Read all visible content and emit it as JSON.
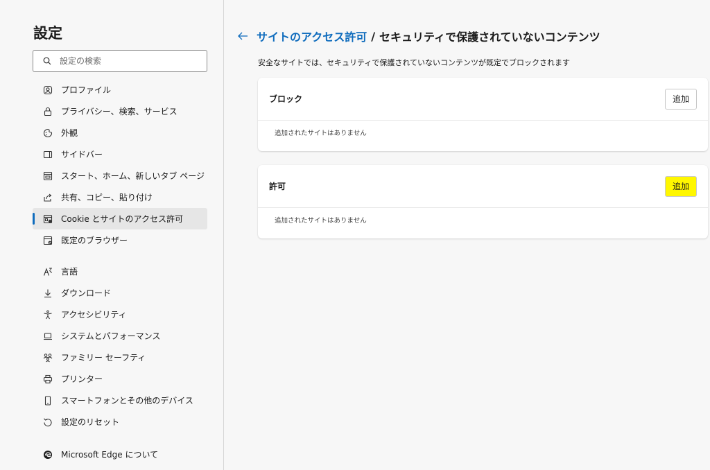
{
  "sidebar": {
    "title": "設定",
    "search_placeholder": "設定の検索",
    "items": [
      {
        "label": "プロファイル",
        "icon": "profile-icon"
      },
      {
        "label": "プライバシー、検索、サービス",
        "icon": "lock-icon"
      },
      {
        "label": "外観",
        "icon": "appearance-icon"
      },
      {
        "label": "サイドバー",
        "icon": "sidebar-icon"
      },
      {
        "label": "スタート、ホーム、新しいタブ ページ",
        "icon": "home-page-icon"
      },
      {
        "label": "共有、コピー、貼り付け",
        "icon": "share-icon"
      },
      {
        "label": "Cookie とサイトのアクセス許可",
        "icon": "cookie-icon",
        "active": true
      },
      {
        "label": "既定のブラウザー",
        "icon": "default-browser-icon"
      },
      {
        "label": "言語",
        "icon": "language-icon"
      },
      {
        "label": "ダウンロード",
        "icon": "download-icon"
      },
      {
        "label": "アクセシビリティ",
        "icon": "accessibility-icon"
      },
      {
        "label": "システムとパフォーマンス",
        "icon": "system-icon"
      },
      {
        "label": "ファミリー セーフティ",
        "icon": "family-icon"
      },
      {
        "label": "プリンター",
        "icon": "printer-icon"
      },
      {
        "label": "スマートフォンとその他のデバイス",
        "icon": "phone-icon"
      },
      {
        "label": "設定のリセット",
        "icon": "reset-icon"
      },
      {
        "label": "Microsoft Edge について",
        "icon": "edge-logo-icon"
      }
    ]
  },
  "main": {
    "breadcrumb_parent": "サイトのアクセス許可",
    "breadcrumb_separator": "/",
    "breadcrumb_current": "セキュリティで保護されていないコンテンツ",
    "description": "安全なサイトでは、セキュリティで保護されていないコンテンツが既定でブロックされます",
    "sections": [
      {
        "title": "ブロック",
        "add_label": "追加",
        "empty_text": "追加されたサイトはありません"
      },
      {
        "title": "許可",
        "add_label": "追加",
        "empty_text": "追加されたサイトはありません",
        "highlighted": true
      }
    ]
  },
  "colors": {
    "accent": "#0f6cbd",
    "highlight": "#fff700"
  }
}
